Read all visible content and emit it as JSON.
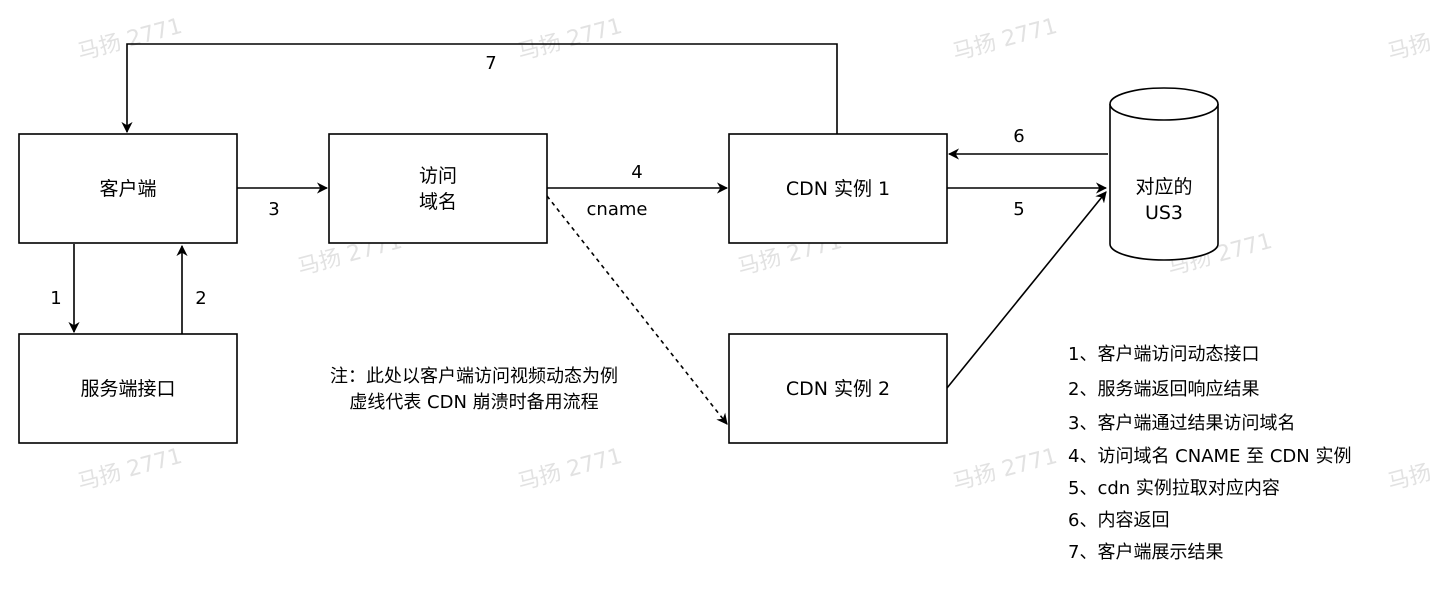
{
  "watermark": "马扬 2771",
  "nodes": {
    "client": {
      "lines": [
        "客户端"
      ]
    },
    "domain": {
      "lines": [
        "访问",
        "域名"
      ]
    },
    "cdn1": {
      "lines": [
        "CDN 实例 1"
      ]
    },
    "server_api": {
      "lines": [
        "服务端接口"
      ]
    },
    "cdn2": {
      "lines": [
        "CDN 实例 2"
      ]
    },
    "us3": {
      "lines": [
        "对应的",
        "US3"
      ]
    }
  },
  "edges": {
    "e1": "1",
    "e2": "2",
    "e3": "3",
    "e4": "4",
    "e4_sub": "cname",
    "e5": "5",
    "e6": "6",
    "e7": "7"
  },
  "note": {
    "line1": "注：此处以客户端访问视频动态为例",
    "line2": "虚线代表 CDN 崩溃时备用流程"
  },
  "legend": [
    "1、客户端访问动态接口",
    "2、服务端返回响应结果",
    "3、客户端通过结果访问域名",
    "4、访问域名 CNAME 至 CDN 实例",
    "5、cdn 实例拉取对应内容",
    "6、内容返回",
    "7、客户端展示结果"
  ]
}
